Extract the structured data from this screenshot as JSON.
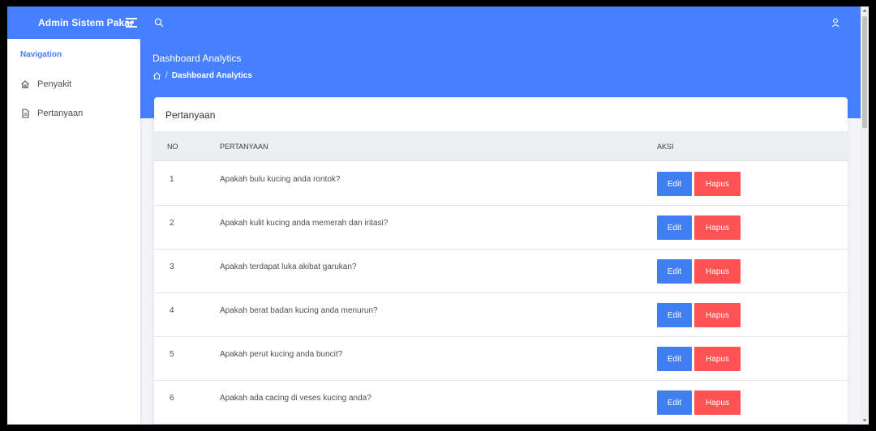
{
  "header": {
    "brand": "Admin Sistem Pakar"
  },
  "banner": {
    "title": "Dashboard Analytics",
    "breadcrumb_separator": "/",
    "breadcrumb_current": "Dashboard Analytics"
  },
  "sidebar": {
    "caption": "Navigation",
    "items": [
      {
        "label": "Penyakit",
        "icon": "home-icon"
      },
      {
        "label": "Pertanyaan",
        "icon": "file-text-icon"
      }
    ]
  },
  "card": {
    "title": "Pertanyaan",
    "columns": [
      "NO",
      "PERTANYAAN",
      "AKSI"
    ],
    "rows": [
      {
        "no": "1",
        "question": "Apakah bulu kucing anda rontok?"
      },
      {
        "no": "2",
        "question": "Apakah kulit kucing anda memerah dan iritasi?"
      },
      {
        "no": "3",
        "question": "Apakah terdapat luka akibat garukan?"
      },
      {
        "no": "4",
        "question": "Apakah berat badan kucing anda menurun?"
      },
      {
        "no": "5",
        "question": "Apakah perut kucing anda buncit?"
      },
      {
        "no": "6",
        "question": "Apakah ada cacing di veses kucing anda?"
      }
    ],
    "edit_label": "Edit",
    "delete_label": "Hapus"
  },
  "colors": {
    "primary": "#4680ff",
    "edit": "#3f7ff2",
    "delete": "#ff5252"
  }
}
